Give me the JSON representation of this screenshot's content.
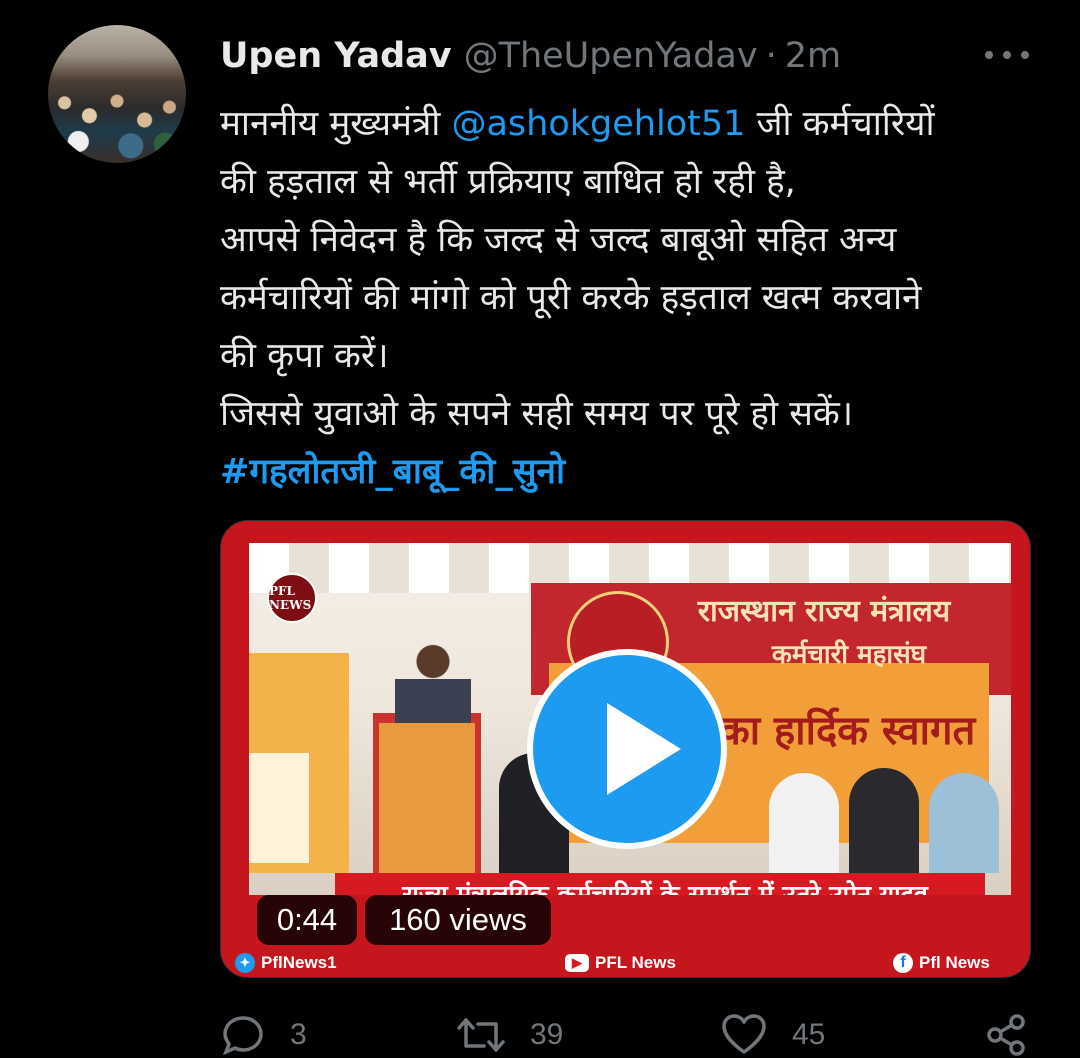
{
  "tweet": {
    "display_name": "Upen Yadav",
    "handle": "@TheUpenYadav",
    "separator": "·",
    "time": "2m",
    "lines": [
      {
        "before": "माननीय मुख्यमंत्री ",
        "mention": "@ashokgehlot51",
        "after": " जी कर्मचारियों"
      },
      {
        "text": "की हड़ताल से भर्ती प्रक्रियाए बाधित हो रही है,"
      },
      {
        "text": "आपसे निवेदन है कि जल्द से जल्द बाबूओ सहित अन्य"
      },
      {
        "text": "कर्मचारियों की मांगो को पूरी करके हड़ताल खत्म करवाने"
      },
      {
        "text": "की कृपा करें।"
      },
      {
        "text": "जिससे युवाओ के सपने सही समय पर पूरे हो सकें।"
      }
    ],
    "hashtag": "#गहलोतजी_बाबू_की_सुनो"
  },
  "video": {
    "duration": "0:44",
    "views": "160 views",
    "logo_text": "PFL NEWS",
    "banner_line1": "राजस्थान राज्य मंत्रालय",
    "banner_line2": "कर्मचारी महासंघ",
    "banner_line3": "का हार्दिक स्वागत",
    "caption": "राज्य मंत्रालयिक कर्मचारियों के समर्थन में उतरे उपेन यादव",
    "footer_twitter": "PflNews1",
    "footer_youtube": "PFL News",
    "footer_facebook": "Pfl News"
  },
  "actions": {
    "replies": "3",
    "retweets": "39",
    "likes": "45"
  },
  "colors": {
    "background": "#000000",
    "text": "#e7e9ea",
    "secondary": "#71767b",
    "link": "#1d9bf0",
    "video_frame": "#c4161c"
  }
}
